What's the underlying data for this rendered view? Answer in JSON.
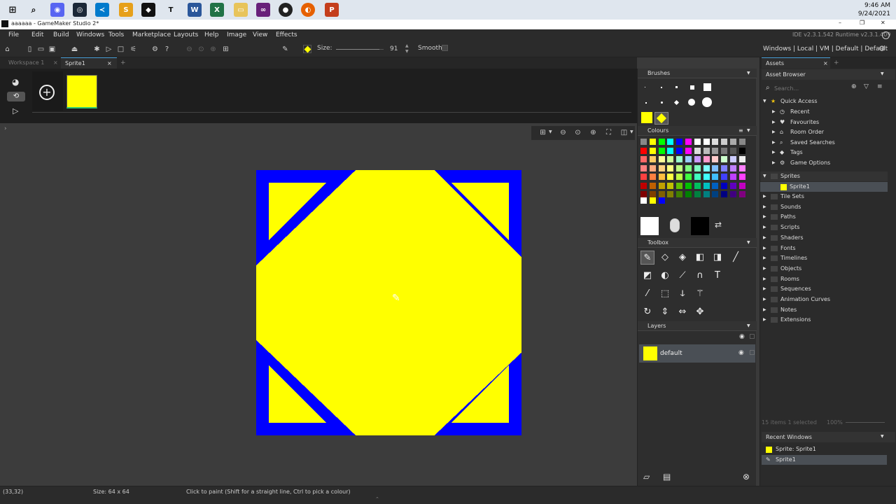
{
  "taskbar": {
    "time": "9:46 AM",
    "date": "9/24/2021"
  },
  "window": {
    "title": "aaaaaa - GameMaker Studio 2*",
    "min": "–",
    "max": "❐",
    "close": "✕"
  },
  "menu": [
    "File",
    "Edit",
    "Build",
    "Windows",
    "Tools",
    "Marketplace",
    "Layouts",
    "Help",
    "Image",
    "View",
    "Effects"
  ],
  "ide_version": "IDE v2.3.1.542  Runtime v2.3.1.409",
  "target_bar": "Windows | Local | VM | Default | Default",
  "toolbar": {
    "size_label": "Size:",
    "size_value": "91",
    "smooth_label": "Smooth",
    "size_fraction": 0.91
  },
  "tabs": [
    "Workspace 1",
    "Sprite1"
  ],
  "tab_add": "+",
  "panels": {
    "brushes": "Brushes",
    "colours": "Colours",
    "toolbox": "Toolbox",
    "layers": "Layers"
  },
  "layer": {
    "name": "default"
  },
  "assets": {
    "tab": "Assets",
    "browser": "Asset Browser",
    "search_placeholder": "Search...",
    "quick_access": "Quick Access",
    "qa_items": [
      "Recent",
      "Favourites",
      "Room Order",
      "Saved Searches",
      "Tags",
      "Game Options"
    ],
    "sprites_group": "Sprites",
    "sprite_item": "Sprite1",
    "groups": [
      "Tile Sets",
      "Sounds",
      "Paths",
      "Scripts",
      "Shaders",
      "Fonts",
      "Timelines",
      "Objects",
      "Rooms",
      "Sequences",
      "Animation Curves",
      "Notes",
      "Extensions"
    ],
    "footer": "15 items   1 selected",
    "zoom": "100%"
  },
  "recent_windows": {
    "title": "Recent Windows",
    "items": [
      "Sprite: Sprite1",
      "Sprite1"
    ]
  },
  "status": {
    "coords": "(33,32)",
    "size": "Size: 64 x 64",
    "hint": "Click to paint (Shift for a straight line, Ctrl to pick a colour)"
  },
  "colors": {
    "sprite_fill": "#ffff00",
    "sprite_border": "#0000ff",
    "accent": "#4a9fd8"
  },
  "palette_rows": [
    [
      "#888888",
      "#ffff00",
      "#00ff00",
      "#00ffff",
      "#0000ff",
      "#ff00ff",
      "#ffffff",
      "#ffffff",
      "#dddddd",
      "#cccccc",
      "#aaaaaa",
      "#888888"
    ],
    [
      "#ff0000",
      "#ffff00",
      "#00ff00",
      "#00ffff",
      "#0000ff",
      "#ff00ff",
      "#dddddd",
      "#bbbbbb",
      "#999999",
      "#777777",
      "#555555",
      "#000000"
    ],
    [
      "#ff6666",
      "#ffcc66",
      "#ffff99",
      "#ccff99",
      "#99ffcc",
      "#99ccff",
      "#cc99ff",
      "#ff99cc",
      "#ffcccc",
      "#ccffcc",
      "#ccccff",
      "#eeeeee"
    ],
    [
      "#ff8080",
      "#ffaa80",
      "#ffd080",
      "#ffff80",
      "#c0ff80",
      "#80ff80",
      "#80ffc0",
      "#80ffff",
      "#80c0ff",
      "#8080ff",
      "#c080ff",
      "#ff80ff"
    ],
    [
      "#ff4040",
      "#ff8040",
      "#ffbf40",
      "#ffff40",
      "#bfff40",
      "#40ff40",
      "#40ffbf",
      "#40ffff",
      "#40bfff",
      "#4040ff",
      "#bf40ff",
      "#ff40ff"
    ],
    [
      "#c00000",
      "#c06000",
      "#c0a000",
      "#c0c000",
      "#60c000",
      "#00c000",
      "#00c060",
      "#00c0c0",
      "#0060c0",
      "#0000c0",
      "#6000c0",
      "#c000c0"
    ],
    [
      "#800000",
      "#804000",
      "#806000",
      "#808000",
      "#408000",
      "#008000",
      "#008040",
      "#008080",
      "#004080",
      "#000080",
      "#400080",
      "#800080"
    ]
  ]
}
